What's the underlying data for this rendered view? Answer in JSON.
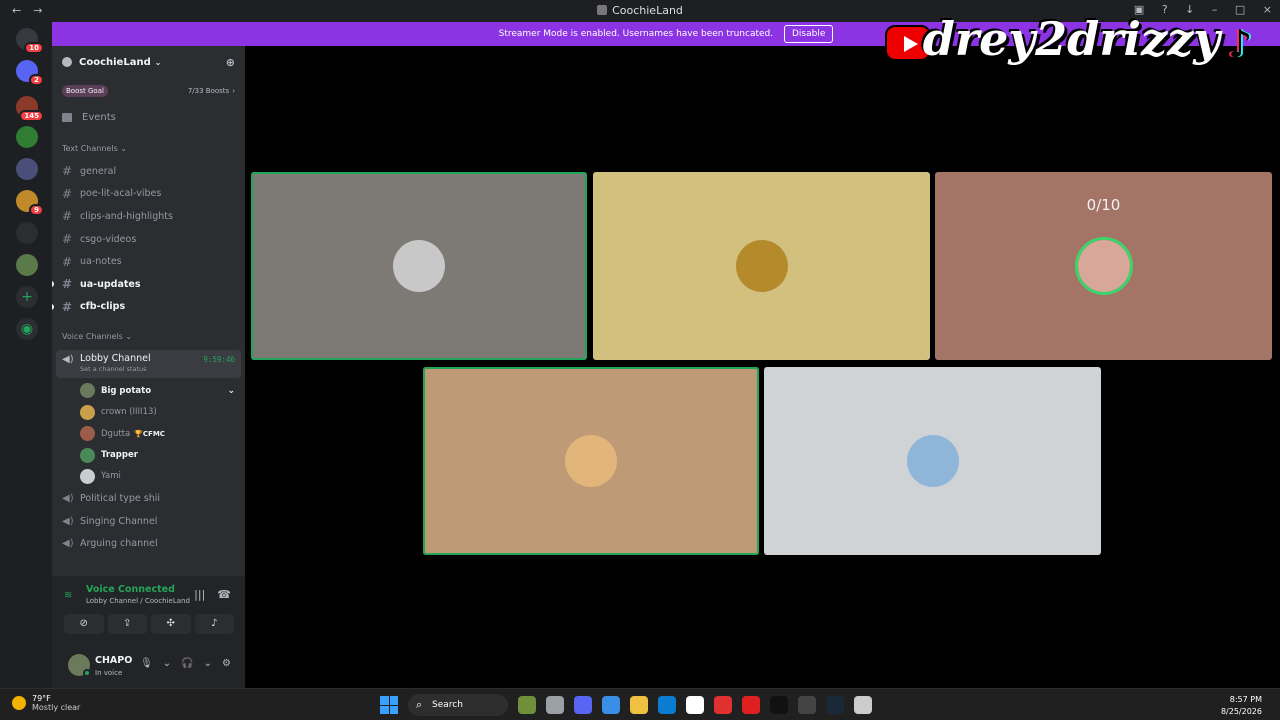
{
  "window": {
    "title": "CoochieLand"
  },
  "banner": {
    "text": "Streamer Mode is enabled. Usernames have been truncated.",
    "button": "Disable"
  },
  "server": {
    "name": "CoochieLand",
    "boost_label": "Boost Goal",
    "boost_count": "7/33 Boosts",
    "events": "Events"
  },
  "guilds": [
    {
      "badge": "10",
      "color": "#36393f"
    },
    {
      "badge": "2",
      "color": "#5865f2"
    },
    {
      "badge": "145",
      "color": "#8b3a2a"
    },
    {
      "badge": "",
      "color": "#2e7d32"
    },
    {
      "badge": "",
      "color": "#4a4f7a"
    },
    {
      "badge": "9",
      "color": "#c08a2a"
    },
    {
      "badge": "",
      "color": "#2b2d31"
    },
    {
      "badge": "",
      "color": "#5a7a4a"
    }
  ],
  "text_channels": {
    "header": "Text Channels",
    "items": [
      {
        "name": "general",
        "unread": false
      },
      {
        "name": "poe-lit-acal-vibes",
        "unread": false
      },
      {
        "name": "clips-and-highlights",
        "unread": false
      },
      {
        "name": "csgo-videos",
        "unread": false
      },
      {
        "name": "ua-notes",
        "unread": false
      },
      {
        "name": "ua-updates",
        "unread": true
      },
      {
        "name": "cfb-clips",
        "unread": true
      }
    ]
  },
  "voice_channels": {
    "header": "Voice Channels",
    "active": {
      "name": "Lobby Channel",
      "status": "Set a channel status",
      "time": "9:59:46"
    },
    "members": [
      {
        "name": "Big potato",
        "tag": "",
        "bold": true,
        "color": "#6b7a5a"
      },
      {
        "name": "crown (IIII13)",
        "tag": "",
        "bold": false,
        "color": "#c9a14a"
      },
      {
        "name": "Dgutta",
        "tag": "🏆CFMC",
        "bold": false,
        "color": "#9b5d4a"
      },
      {
        "name": "Trapper",
        "tag": "",
        "bold": true,
        "color": "#4a8a5a"
      },
      {
        "name": "Yami",
        "tag": "",
        "bold": false,
        "color": "#c8cdd2"
      }
    ],
    "others": [
      "Political type shii",
      "Singing Channel",
      "Arguing channel"
    ]
  },
  "voice_panel": {
    "status": "Voice Connected",
    "location": "Lobby Channel / CoochieLand"
  },
  "user": {
    "name": "CHAPO",
    "status": "In voice"
  },
  "stage": {
    "tiles": [
      {
        "id": "a",
        "bg": "#7d7a76",
        "pfp": "#c8c8c8",
        "speaking": true,
        "counter": ""
      },
      {
        "id": "b",
        "bg": "#d2c07f",
        "pfp": "#b58a2a",
        "speaking": false,
        "counter": ""
      },
      {
        "id": "c",
        "bg": "#a47567",
        "pfp": "#d8a79a",
        "speaking": false,
        "counter": "0/10"
      },
      {
        "id": "d",
        "bg": "#bf9a76",
        "pfp": "#e2b57a",
        "speaking": true,
        "counter": ""
      },
      {
        "id": "e",
        "bg": "#cfd3d6",
        "pfp": "#8fb6d8",
        "speaking": false,
        "counter": ""
      }
    ]
  },
  "watermark": "drey2drizzy",
  "taskbar": {
    "temp": "79°F",
    "weather": "Mostly clear",
    "search": "Search",
    "time": "8:57 PM",
    "date": "8/25/2026",
    "apps": [
      "#6f8f3a",
      "#9aa0a6",
      "#5865f2",
      "#3a8ee6",
      "#f0c040",
      "#0a7cd1",
      "#ffffff",
      "#e03030",
      "#e02020",
      "#111111",
      "#444444",
      "#1b2838",
      "#cccccc"
    ]
  }
}
